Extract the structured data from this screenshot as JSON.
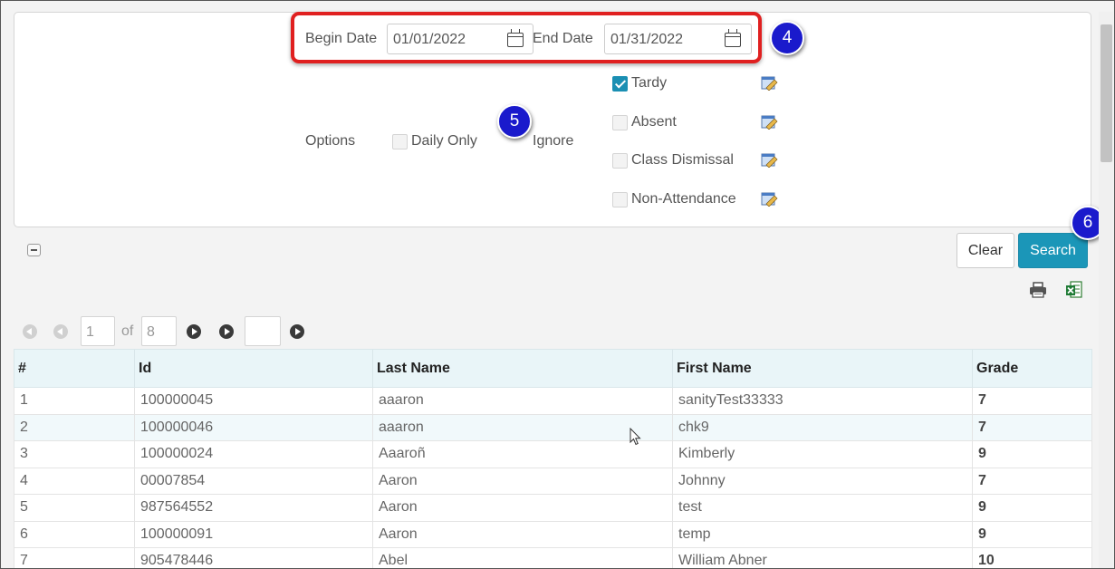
{
  "criteria": {
    "begin_date_label": "Begin Date",
    "begin_date_value": "01/01/2022",
    "end_date_label": "End Date",
    "end_date_value": "01/31/2022",
    "options_label": "Options",
    "daily_only_label": "Daily Only",
    "ignore_label": "Ignore",
    "ignore_options": [
      {
        "label": "Tardy",
        "checked": true
      },
      {
        "label": "Absent",
        "checked": false
      },
      {
        "label": "Class Dismissal",
        "checked": false
      },
      {
        "label": "Non-Attendance",
        "checked": false
      }
    ]
  },
  "callouts": {
    "dates": "4",
    "options": "5",
    "search": "6"
  },
  "actions": {
    "clear_label": "Clear",
    "search_label": "Search"
  },
  "pager": {
    "current_page": "1",
    "of_label": "of",
    "total_pages": "8",
    "goto_value": ""
  },
  "table": {
    "columns": [
      "#",
      "Id",
      "Last Name",
      "First Name",
      "Grade"
    ],
    "rows": [
      [
        "1",
        "100000045",
        "aaaron",
        "sanityTest33333",
        "7"
      ],
      [
        "2",
        "100000046",
        "aaaron",
        "chk9",
        "7"
      ],
      [
        "3",
        "100000024",
        "Aaaroñ",
        "Kimberly",
        "9"
      ],
      [
        "4",
        "00007854",
        "Aaron",
        "Johnny",
        "7"
      ],
      [
        "5",
        "987564552",
        "Aaron",
        "test",
        "9"
      ],
      [
        "6",
        "100000091",
        "Aaron",
        "temp",
        "9"
      ],
      [
        "7",
        "905478446",
        "Abel",
        "William Abner",
        "10"
      ]
    ]
  },
  "colors": {
    "accent": "#1b96b8",
    "callout_badge": "#1a1acc",
    "highlight_border": "#e02020",
    "header_bg": "#e9f5f8"
  }
}
